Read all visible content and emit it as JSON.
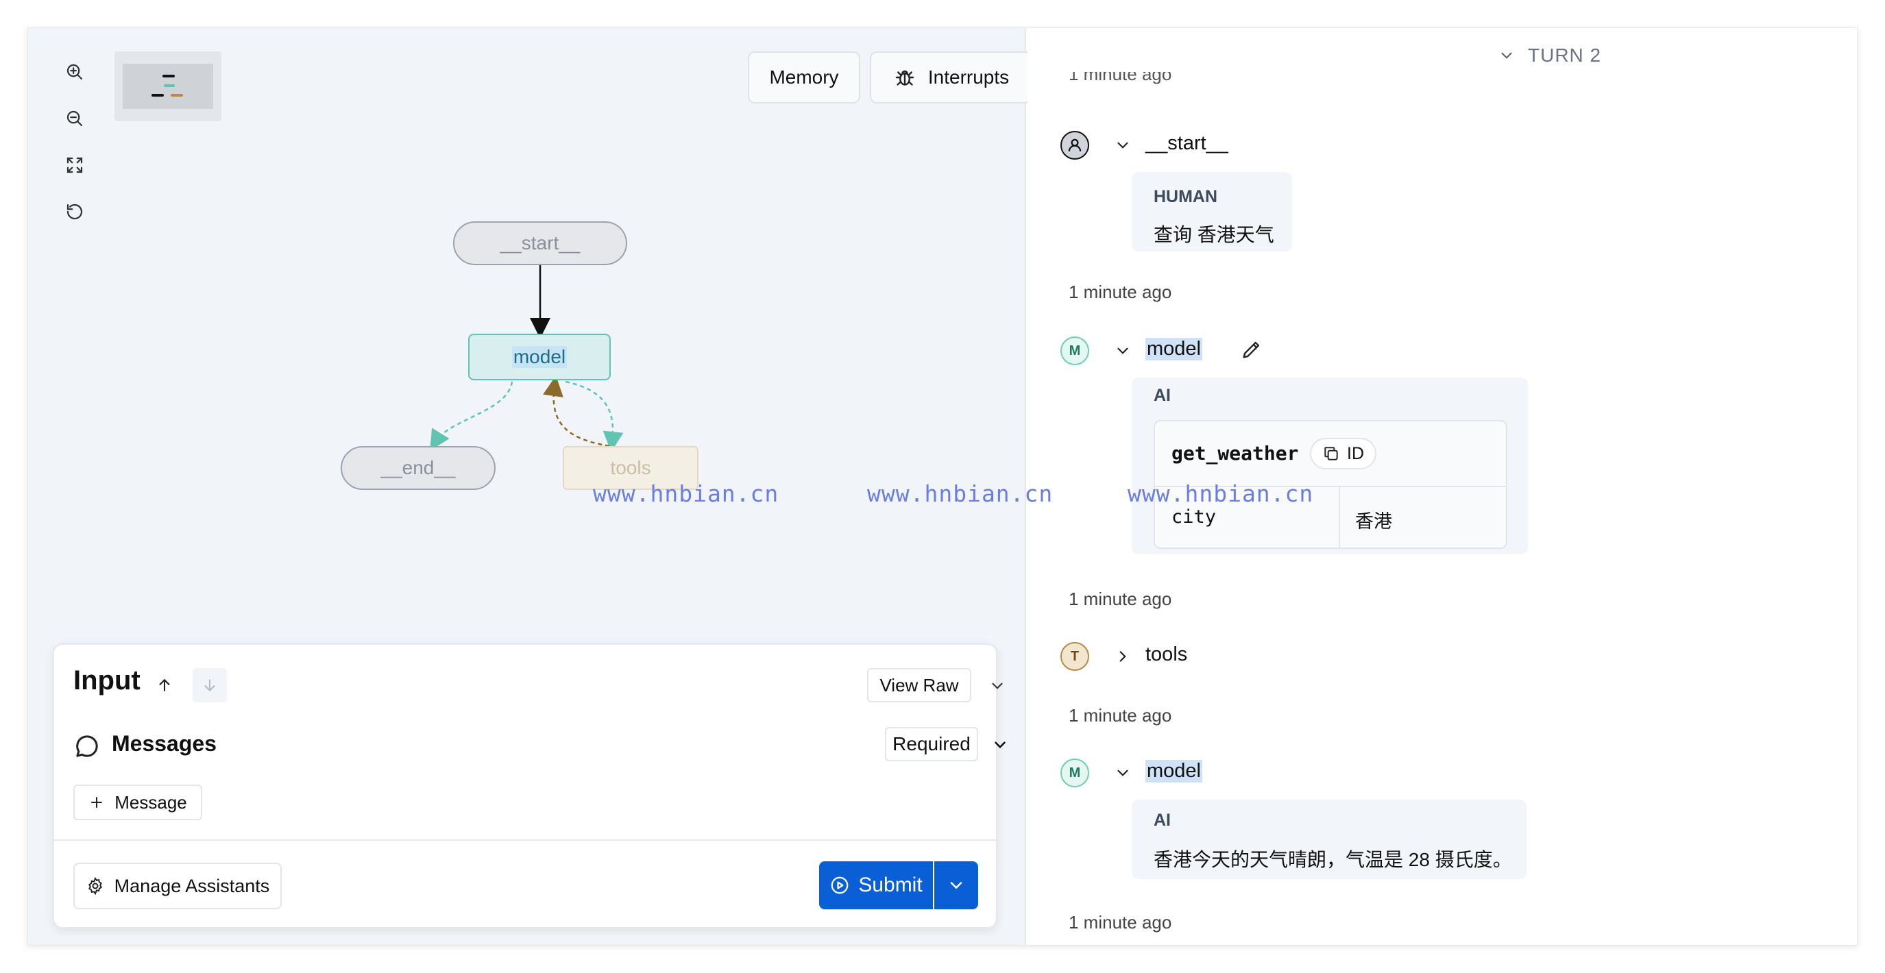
{
  "graph": {
    "nodes": {
      "start": "__start__",
      "model": "model",
      "end": "__end__",
      "tools": "tools"
    },
    "buttons": {
      "memory": "Memory",
      "interrupts": "Interrupts"
    },
    "watermarks": [
      "www.hnbian.cn",
      "www.hnbian.cn",
      "www.hnbian.cn"
    ],
    "colors": {
      "accent_teal": "#60c3b3",
      "tools_edge": "#8b6a2a"
    }
  },
  "input_panel": {
    "title": "Input",
    "view_raw": "View Raw",
    "messages_label": "Messages",
    "required_label": "Required",
    "add_message": "Message",
    "manage_assistants": "Manage Assistants",
    "submit": "Submit",
    "submit_color": "#0b5fd6"
  },
  "trace": {
    "turn_label": "TURN 2",
    "cut_timestamp": "1 minute ago",
    "steps": [
      {
        "avatar": "",
        "name": "__start__",
        "role": "HUMAN",
        "content": "查询 香港天气",
        "timestamp": "1 minute ago"
      },
      {
        "avatar": "M",
        "name": "model",
        "role": "AI",
        "tool_call": {
          "name": "get_weather",
          "id_label": "ID",
          "arg_key": "city",
          "arg_value": "香港"
        },
        "timestamp": "1 minute ago"
      },
      {
        "avatar": "T",
        "name": "tools",
        "timestamp": "1 minute ago"
      },
      {
        "avatar": "M",
        "name": "model",
        "role": "AI",
        "content": "香港今天的天气晴朗，气温是 28 摄氏度。",
        "timestamp": "1 minute ago"
      }
    ]
  }
}
